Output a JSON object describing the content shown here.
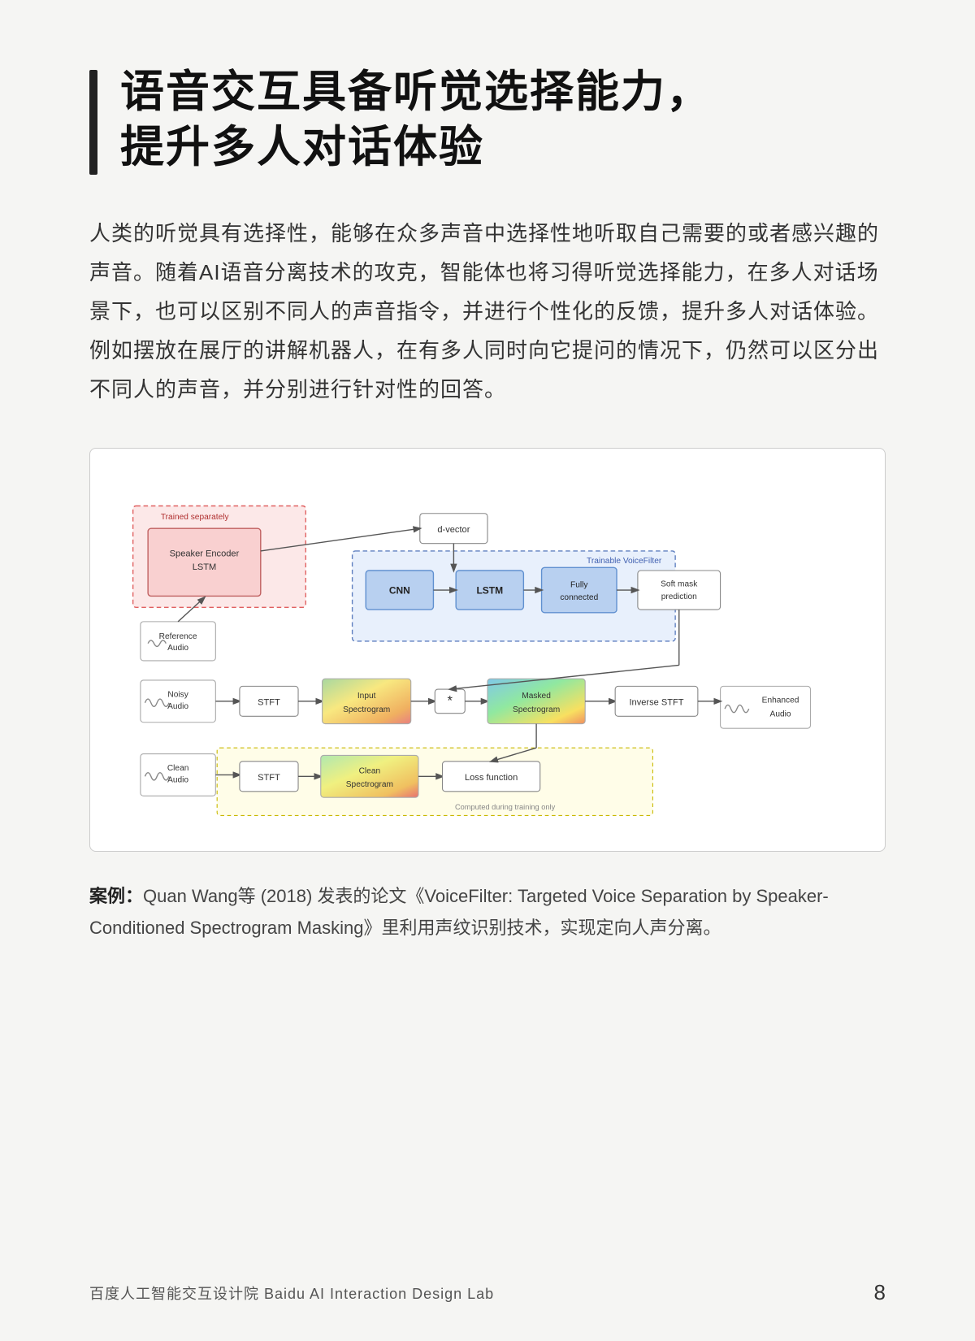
{
  "page": {
    "background": "#f5f5f3"
  },
  "header": {
    "accent_color": "#111",
    "title_line1": "语音交互具备听觉选择能力，",
    "title_line2": "提升多人对话体验"
  },
  "body": {
    "paragraph": "人类的听觉具有选择性，能够在众多声音中选择性地听取自己需要的或者感兴趣的声音。随着AI语音分离技术的攻克，智能体也将习得听觉选择能力，在多人对话场景下，也可以区别不同人的声音指令，并进行个性化的反馈，提升多人对话体验。例如摆放在展厅的讲解机器人，在有多人同时向它提问的情况下，仍然可以区分出不同人的声音，并分别进行针对性的回答。"
  },
  "diagram": {
    "trained_separately": "Trained separately",
    "speaker_encoder": "Speaker Encoder\nLSTM",
    "d_vector": "d-vector",
    "trainable_voicefilter": "Trainable VoiceFilter",
    "cnn": "CNN",
    "lstm": "LSTM",
    "fully_connected": "Fully\nconnected",
    "soft_mask": "Soft mask\nprediction",
    "reference_audio": "Reference\nAudio",
    "noisy_audio": "Noisy\nAudio",
    "stft1": "STFT",
    "input_spectrogram": "Input\nSpectrogram",
    "star": "*",
    "masked_spectrogram": "Masked\nSpectrogram",
    "inverse_stft": "Inverse STFT",
    "clean_audio": "Clean\nAudio",
    "stft2": "STFT",
    "clean_spectrogram": "Clean\nSpectrogram",
    "loss_function": "Loss function",
    "computed_training": "Computed during training only",
    "enhanced_audio": "Enhanced\nAudio"
  },
  "caption": {
    "label": "案例：",
    "text": "Quan Wang等 (2018) 发表的论文《VoiceFilter: Targeted Voice Separation by Speaker-Conditioned Spectrogram Masking》里利用声纹识别技术，实现定向人声分离。"
  },
  "footer": {
    "left": "百度人工智能交互设计院   Baidu AI Interaction Design Lab",
    "page_number": "8"
  }
}
